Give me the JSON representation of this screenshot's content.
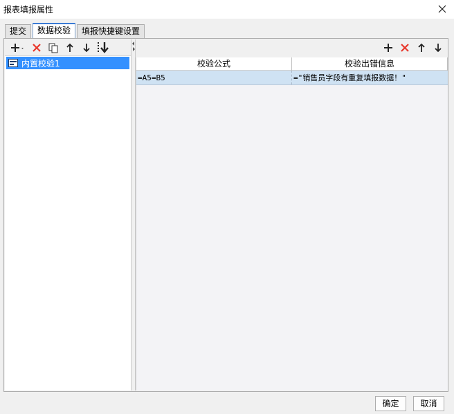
{
  "window": {
    "title": "报表填报属性"
  },
  "tabs": [
    {
      "label": "提交",
      "active": false
    },
    {
      "label": "数据校验",
      "active": true
    },
    {
      "label": "填报快捷键设置",
      "active": false
    }
  ],
  "left_toolbar": {
    "icons": [
      "add-dropdown-icon",
      "delete-icon",
      "copy-icon",
      "move-up-icon",
      "move-down-icon",
      "move-bottom-icon"
    ]
  },
  "tree": {
    "items": [
      {
        "label": "内置校验1",
        "selected": true,
        "icon": "builtin-check-icon"
      }
    ]
  },
  "right_toolbar": {
    "icons": [
      "add-icon",
      "delete-icon",
      "move-up-icon",
      "move-down-icon"
    ]
  },
  "table": {
    "columns": [
      "校验公式",
      "校验出错信息"
    ],
    "rows": [
      {
        "formula": "=A5=B5",
        "message": "=\"销售员字段有重复填报数据！\""
      }
    ]
  },
  "buttons": {
    "ok": "确定",
    "cancel": "取消"
  },
  "colors": {
    "accent": "#3390ff",
    "delete": "#e8372c",
    "selected_row": "#cfe2f3"
  }
}
